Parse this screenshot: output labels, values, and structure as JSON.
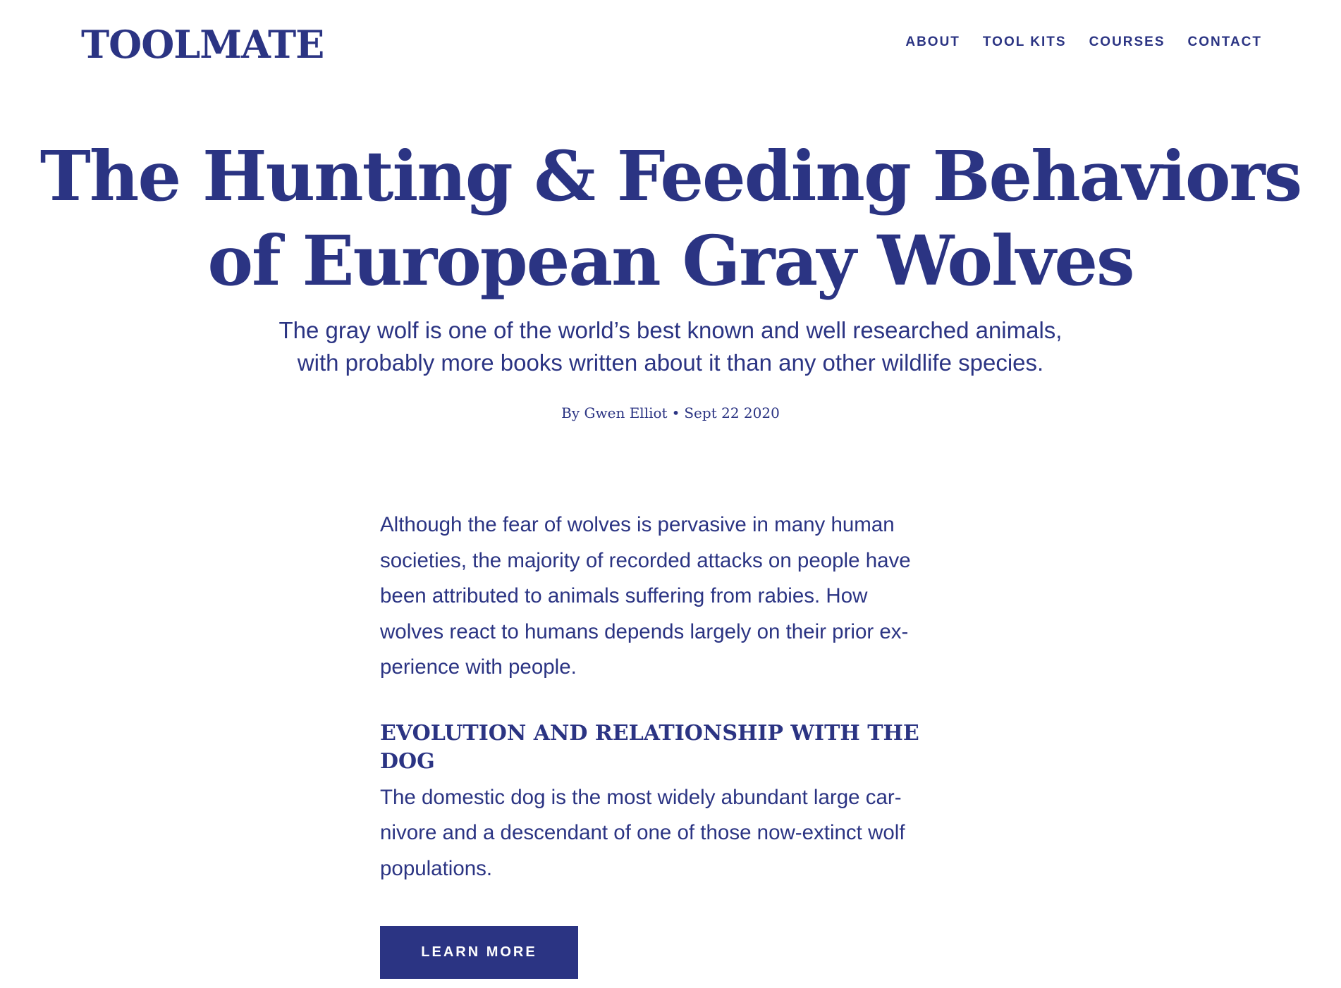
{
  "header": {
    "logo": "TOOLMATE",
    "nav": [
      {
        "label": "ABOUT"
      },
      {
        "label": "TOOL KITS"
      },
      {
        "label": "COURSES"
      },
      {
        "label": "CONTACT"
      }
    ]
  },
  "hero": {
    "title_line1": "The Hunting & Feeding Behaviors",
    "title_line2": "of European Gray Wolves",
    "subtitle_line1": "The gray wolf is one of the world’s best known and well researched animals,",
    "subtitle_line2": "with probably more books written about it than any other wildlife species.",
    "author": "By Gwen Elliot",
    "separator": "•",
    "date": "Sept 22 2020"
  },
  "article": {
    "paragraph1_lines": [
      "Although the fear of wolves is pervasive in many human",
      "societies, the majority of recorded attacks on people have",
      "been attributed to animals suffering from rabies. How",
      "wolves react to humans depends largely on their prior ex-",
      "perience with people."
    ],
    "section_heading": "EVOLUTION AND RELATIONSHIP WITH THE DOG",
    "paragraph2_lines": [
      "The domestic dog is the most widely abundant large car-",
      "nivore and a descendant of one of those now-extinct wolf",
      "populations."
    ],
    "cta_label": "LEARN MORE"
  },
  "colors": {
    "brand": "#2b3483",
    "background": "#ffffff",
    "button_text": "#ffffff"
  }
}
